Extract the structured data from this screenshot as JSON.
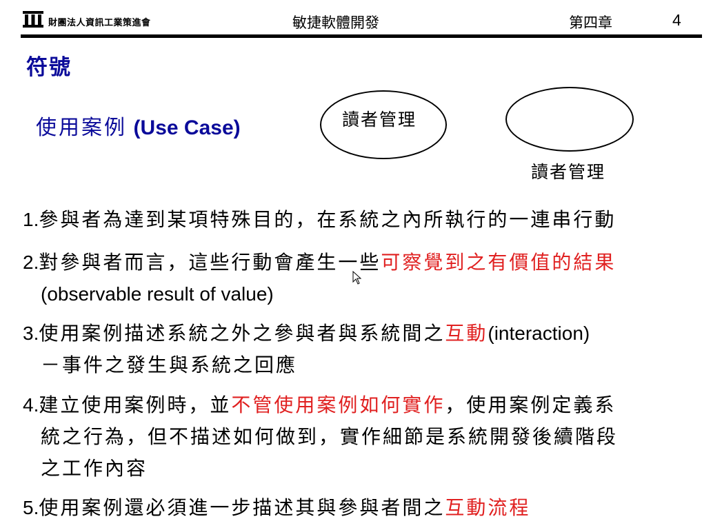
{
  "header": {
    "org_name": "財團法人資訊工業策進會",
    "course_title": "敏捷軟體開發",
    "chapter": "第四章",
    "page_number": "4"
  },
  "section_title": "符號",
  "usecase": {
    "title_zh": "使用案例",
    "title_en": "(Use Case)",
    "ellipse_label": "讀者管理",
    "below_label": "讀者管理"
  },
  "items": [
    {
      "num": "1.",
      "line1": "參與者為達到某項特殊目的，在系統之內所執行的一連串行動"
    },
    {
      "num": "2.",
      "line1_black": "對參與者而言，這些行動會產生一些",
      "line1_red": "可察覺到之有價值的結果",
      "line2": "(observable result of value)"
    },
    {
      "num": "3.",
      "line1_black": "使用案例描述系統之外之參與者與系統間之",
      "line1_red": "互動",
      "line1_en": "(interaction)",
      "line2": "－事件之發生與系統之回應"
    },
    {
      "num": "4.",
      "line1_black_a": "建立使用案例時，並",
      "line1_red": "不管使用案例如何實作",
      "line1_black_b": "，使用案例定義系",
      "line2": "統之行為，但不描述如何做到，實作細節是系統開發後續階段",
      "line3": "之工作內容"
    },
    {
      "num": "5.",
      "line1_black": "使用案例還必須進一步描述其與參與者間之",
      "line1_red": "互動流程"
    }
  ],
  "colors": {
    "title_blue": "#0b0b9a",
    "emphasis_red": "#e02020"
  }
}
